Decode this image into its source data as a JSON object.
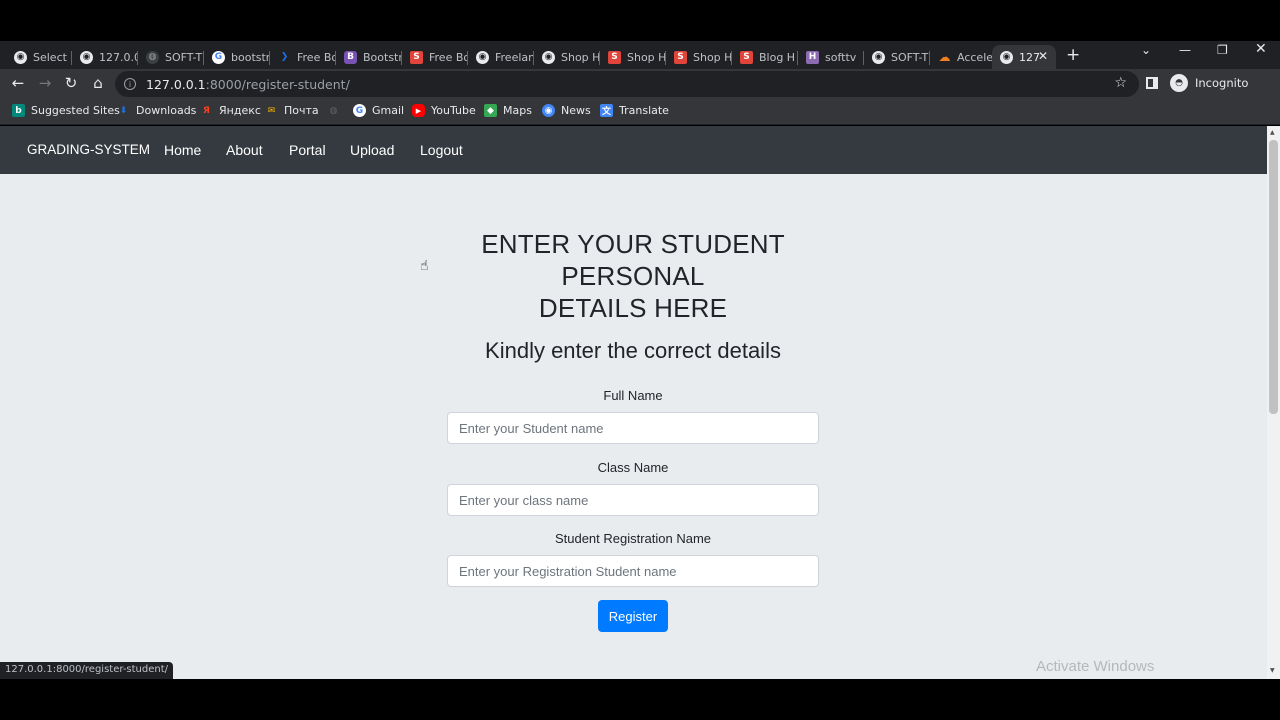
{
  "browser": {
    "tabs": [
      {
        "title": "Select",
        "icon": "globe-icon",
        "color": "#e8eaed"
      },
      {
        "title": "127.0.0",
        "icon": "globe-icon",
        "color": "#e8eaed"
      },
      {
        "title": "SOFT-T",
        "icon": "world-icon",
        "color": "#3c4043"
      },
      {
        "title": "bootstr",
        "icon": "google-icon",
        "color": "#ffffff"
      },
      {
        "title": "Free Bo",
        "icon": "arrow-logo-icon",
        "color": "#1a73e8"
      },
      {
        "title": "Bootstr",
        "icon": "bootstrap-b-icon",
        "color": "#7952b3"
      },
      {
        "title": "Free Bo",
        "icon": "s-logo-icon",
        "color": "#e0443a"
      },
      {
        "title": "Freelan",
        "icon": "globe-icon",
        "color": "#e8eaed"
      },
      {
        "title": "Shop H",
        "icon": "globe-icon",
        "color": "#e8eaed"
      },
      {
        "title": "Shop H",
        "icon": "s-logo-icon",
        "color": "#e0443a"
      },
      {
        "title": "Shop H",
        "icon": "s-logo-icon",
        "color": "#e0443a"
      },
      {
        "title": "Blog H",
        "icon": "s-logo-icon",
        "color": "#e0443a"
      },
      {
        "title": "softtv",
        "icon": "h-logo-icon",
        "color": "#8c6bb1"
      },
      {
        "title": "SOFT-T",
        "icon": "globe-icon",
        "color": "#e8eaed"
      },
      {
        "title": "Acceler",
        "icon": "cloud-icon",
        "color": "#f38020"
      },
      {
        "title": "127",
        "icon": "globe-icon",
        "color": "#e8eaed"
      }
    ],
    "url_host": "127.0.0.1",
    "url_path": ":8000/register-student/",
    "incognito_label": "Incognito",
    "bookmarks": [
      {
        "label": "Suggested Sites",
        "icon": "bing-icon",
        "color": "#00897b"
      },
      {
        "label": "Downloads",
        "icon": "download-icon",
        "color": "#1a73e8"
      },
      {
        "label": "Яндекс",
        "icon": "yandex-icon",
        "color": "#fc3f1d"
      },
      {
        "label": "Почта",
        "icon": "mail-icon",
        "color": "#f5b400"
      },
      {
        "label": "",
        "icon": "blank-site-icon",
        "color": "#5f6368"
      },
      {
        "label": "Gmail",
        "icon": "google-icon",
        "color": "#ffffff"
      },
      {
        "label": "YouTube",
        "icon": "youtube-icon",
        "color": "#ff0000"
      },
      {
        "label": "Maps",
        "icon": "maps-icon",
        "color": "#34a853"
      },
      {
        "label": "News",
        "icon": "news-icon",
        "color": "#4285f4"
      },
      {
        "label": "Translate",
        "icon": "translate-icon",
        "color": "#4285f4"
      }
    ]
  },
  "navbar": {
    "brand": "GRADING-SYSTEM",
    "links": [
      "Home",
      "About",
      "Portal",
      "Upload",
      "Logout"
    ]
  },
  "main": {
    "heading_line1": "ENTER YOUR STUDENT PERSONAL",
    "heading_line2": "DETAILS HERE",
    "subheading": "Kindly enter the correct details",
    "fields": [
      {
        "label": "Full Name",
        "placeholder": "Enter your Student name"
      },
      {
        "label": "Class Name",
        "placeholder": "Enter your class name"
      },
      {
        "label": "Student Registration Name",
        "placeholder": "Enter your Registration Student name"
      }
    ],
    "submit_label": "Register"
  },
  "status_url": "127.0.0.1:8000/register-student/",
  "watermark": "Activate Windows",
  "colors": {
    "navbar_bg": "#343a40",
    "page_bg": "#e9ecef",
    "primary": "#007bff"
  }
}
